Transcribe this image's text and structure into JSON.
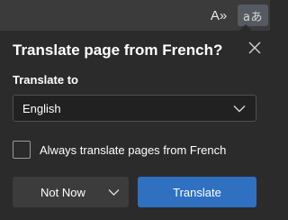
{
  "toolbar": {
    "read_aloud_icon": "read-aloud-icon",
    "read_aloud_glyph": "A»",
    "translate_icon": "translate-icon",
    "translate_glyph": "aあ"
  },
  "translate_flyout": {
    "title": "Translate page from French?",
    "translate_to_label": "Translate to",
    "selected_language": "English",
    "always_translate_label": "Always translate pages from French",
    "always_translate_checked": false,
    "not_now_label": "Not Now",
    "translate_label": "Translate"
  },
  "colors": {
    "background": "#2b2b2b",
    "toolbar": "#3b3b3b",
    "primary_button": "#2f71c0",
    "secondary_button": "#3c3c3c"
  }
}
